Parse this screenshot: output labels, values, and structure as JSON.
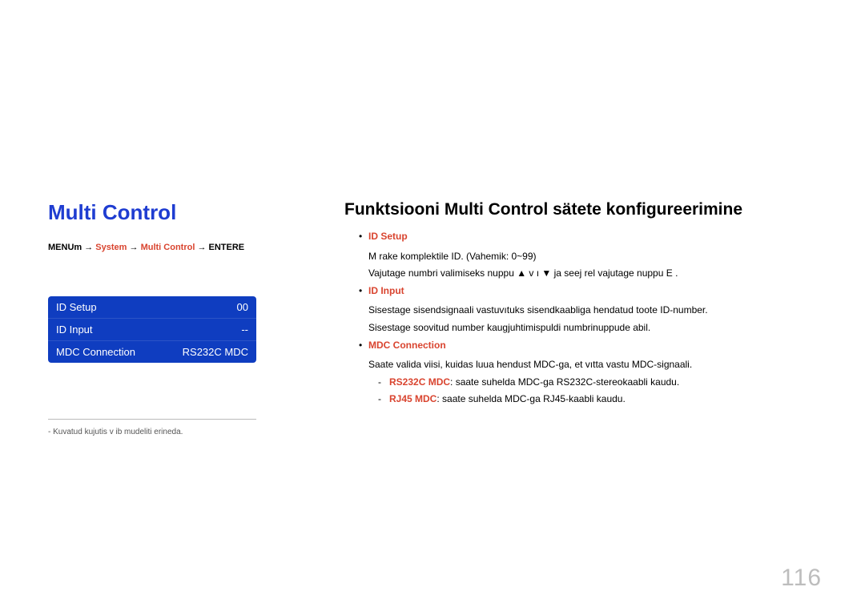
{
  "left": {
    "title": "Multi Control",
    "breadcrumb": {
      "p1": "MENU",
      "p1s": "m",
      "arr1": " → ",
      "p2": "System",
      "arr2": " → ",
      "p3": "Multi Control",
      "arr3": " → ",
      "p4": "ENTER",
      "p4s": "E"
    },
    "menu": [
      {
        "label": "ID Setup",
        "value": "00"
      },
      {
        "label": "ID Input",
        "value": "--"
      },
      {
        "label": "MDC Connection",
        "value": "RS232C MDC"
      }
    ],
    "footnote_dash": "- ",
    "footnote": "Kuvatud kujutis v ib mudeliti erineda."
  },
  "right": {
    "title": "Funktsiooni Multi Control sätete konfigureerimine",
    "items": [
      {
        "head": "ID Setup",
        "lines": [
          "M  rake komplektile ID. (Vahemik: 0~99)",
          "Vajutage numbri valimiseks nuppu ▲ v ı ▼ ja seej rel vajutage nuppu E   ."
        ],
        "subs": []
      },
      {
        "head": "ID Input",
        "lines": [
          "Sisestage sisendsignaali vastuvıtuks sisendkaabliga  hendatud toote ID-number.",
          "Sisestage soovitud number kaugjuhtimispuldi numbrinuppude abil."
        ],
        "subs": []
      },
      {
        "head": "MDC Connection",
        "lines": [
          "Saate valida viisi, kuidas luua  hendust MDC-ga, et vıtta vastu MDC-signaali."
        ],
        "subs": [
          {
            "bold": "RS232C MDC",
            "text": ": saate suhelda MDC-ga RS232C-stereokaabli kaudu."
          },
          {
            "bold": "RJ45 MDC",
            "text": ": saate suhelda MDC-ga RJ45-kaabli kaudu."
          }
        ]
      }
    ]
  },
  "page_number": "116"
}
